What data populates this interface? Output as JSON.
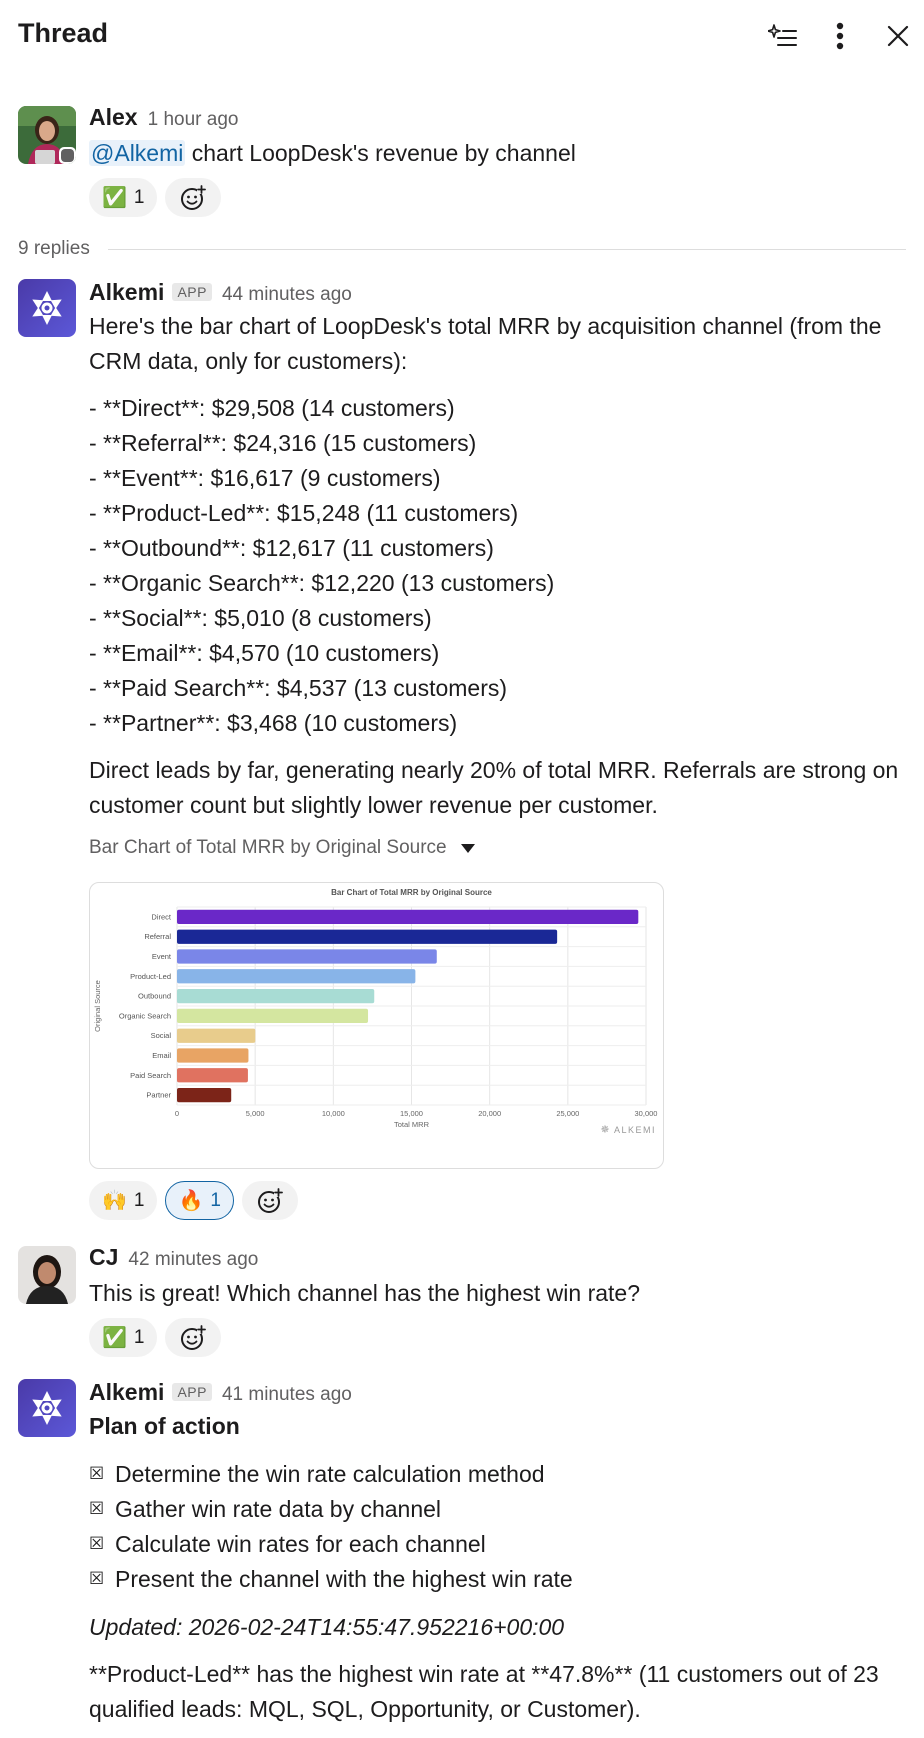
{
  "header": {
    "title": "Thread",
    "icons": [
      "ai-sparkle-list-icon",
      "more-vertical-icon",
      "close-icon"
    ]
  },
  "parent_message": {
    "author": "Alex",
    "timestamp": "1 hour ago",
    "mention": "@Alkemi",
    "text": "chart LoopDesk's revenue by channel",
    "reactions": [
      {
        "emoji": "✅",
        "count": "1"
      }
    ]
  },
  "replies": {
    "label": "9 replies"
  },
  "reply1": {
    "author": "Alkemi",
    "badge": "APP",
    "timestamp": "44 minutes ago",
    "intro": "Here's the bar chart of LoopDesk's total MRR by acquisition channel (from the CRM data, only for customers):",
    "bullets": [
      "- **Direct**: $29,508 (14 customers)",
      "- **Referral**: $24,316 (15 customers)",
      "- **Event**: $16,617 (9 customers)",
      "- **Product-Led**: $15,248 (11 customers)",
      "- **Outbound**: $12,617 (11 customers)",
      "- **Organic Search**: $12,220 (13 customers)",
      "- **Social**: $5,010 (8 customers)",
      "- **Email**: $4,570 (10 customers)",
      "- **Paid Search**: $4,537 (13 customers)",
      "- **Partner**: $3,468 (10 customers)"
    ],
    "summary": "Direct leads by far, generating nearly 20% of total MRR. Referrals are strong on customer count but slightly lower revenue per customer.",
    "attachment_title": "Bar Chart of Total MRR by Original Source",
    "reactions": [
      {
        "emoji": "🙌",
        "count": "1",
        "active": false
      },
      {
        "emoji": "🔥",
        "count": "1",
        "active": true
      }
    ]
  },
  "chart_data": {
    "type": "bar",
    "orientation": "horizontal",
    "title": "Bar Chart of Total MRR by Original Source",
    "xlabel": "Total MRR",
    "ylabel": "Original Source",
    "categories": [
      "Direct",
      "Referral",
      "Event",
      "Product-Led",
      "Outbound",
      "Organic Search",
      "Social",
      "Email",
      "Paid Search",
      "Partner"
    ],
    "values": [
      29508,
      24316,
      16617,
      15248,
      12617,
      12220,
      5010,
      4570,
      4537,
      3468
    ],
    "colors": [
      "#6a28c8",
      "#1a2896",
      "#7a86e8",
      "#88b4e8",
      "#a8dcd4",
      "#d4e6a0",
      "#e8cc8c",
      "#e8a464",
      "#e07260",
      "#7c2418"
    ],
    "xlim": [
      0,
      30000
    ],
    "xticks": [
      "0",
      "5,000",
      "10,000",
      "15,000",
      "20,000",
      "25,000",
      "30,000"
    ],
    "grid": true,
    "watermark": "ALKEMI"
  },
  "cj_message": {
    "author": "CJ",
    "timestamp": "42 minutes ago",
    "text": "This is great! Which channel has the highest win rate?",
    "reactions": [
      {
        "emoji": "✅",
        "count": "1"
      }
    ]
  },
  "reply2": {
    "author": "Alkemi",
    "badge": "APP",
    "timestamp": "41 minutes ago",
    "plan_title": "Plan of action",
    "checkbox_glyph": "☒",
    "plan_items": [
      "Determine the win rate calculation method",
      "Gather win rate data by channel",
      "Calculate win rates for each channel",
      "Present the channel with the highest win rate"
    ],
    "updated": "Updated: 2026-02-24T14:55:47.952216+00:00",
    "answer": "**Product-Led** has the highest win rate at **47.8%** (11 customers out of 23 qualified leads: MQL, SQL, Opportunity, or Customer)."
  }
}
